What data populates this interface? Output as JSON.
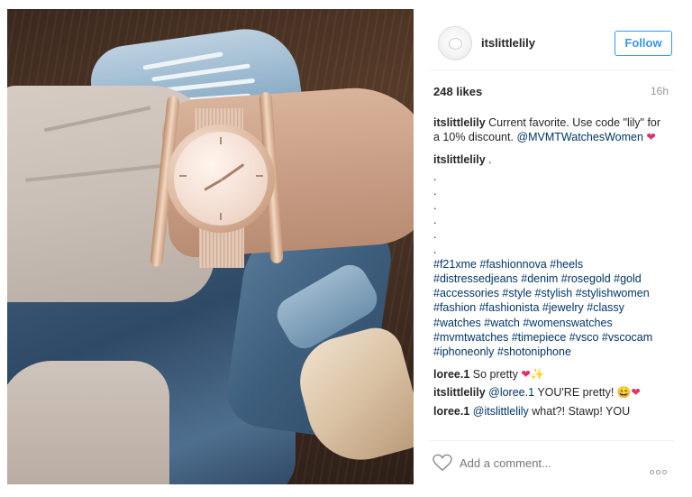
{
  "post": {
    "username": "itslittlelily",
    "follow_label": "Follow",
    "likes": "248 likes",
    "time_ago": "16h"
  },
  "comments": [
    {
      "user": "itslittlelily",
      "text": "Current favorite. Use code \"lily\" for a 10% discount.",
      "mention": "@MVMTWatchesWomen",
      "emoji": "❤"
    },
    {
      "user": "itslittlelily",
      "text": "."
    },
    {
      "dots": [
        ".",
        ".",
        ".",
        ".",
        ".",
        "."
      ]
    },
    {
      "hashtags": "#f21xme #fashionnova #heels #distressedjeans #denim #rosegold #gold #accessories #style #stylish #stylishwomen #fashion #fashionista #jewelry #classy #watches #watch #womenswatches #mvmtwatches #timepiece #vsco #vscocam #iphoneonly #shotoniphone"
    },
    {
      "user": "loree.1",
      "text": "So pretty",
      "emoji": "❤✨"
    },
    {
      "user": "itslittlelily",
      "mention": "@loree.1",
      "text": "YOU'RE pretty!",
      "emoji": "😄❤"
    },
    {
      "user": "loree.1",
      "mention": "@itslittlelily",
      "text": "what?! Stawp! YOU"
    }
  ],
  "footer": {
    "comment_placeholder": "Add a comment..."
  },
  "icons": {
    "like": "heart-outline-icon",
    "more": "more-options-icon"
  },
  "colors": {
    "accent": "#3897f0",
    "link": "#003569",
    "heart": "#e1306c"
  }
}
